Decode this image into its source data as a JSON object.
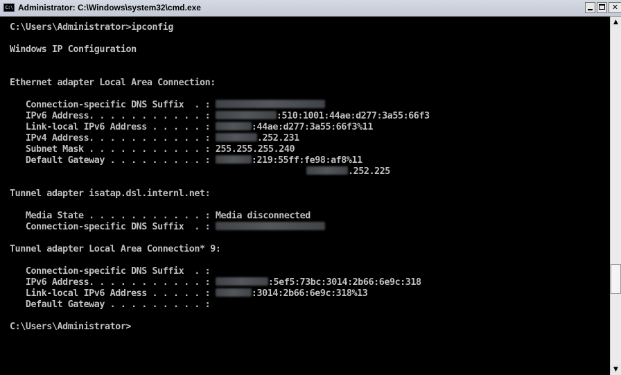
{
  "window": {
    "title": "Administrator: C:\\Windows\\system32\\cmd.exe",
    "icon": "cmd-icon",
    "icon_text": "C:\\",
    "min_label": "",
    "max_label": "",
    "close_label": "✕"
  },
  "console": {
    "prompt1": "C:\\Users\\Administrator>ipconfig",
    "header": "Windows IP Configuration",
    "eth": {
      "heading": "Ethernet adapter Local Area Connection:",
      "dns_label": "   Connection-specific DNS Suffix  . :",
      "ipv6_label": "   IPv6 Address. . . . . . . . . . . :",
      "ipv6_value": ":510:1001:44ae:d277:3a55:66f3",
      "linklocal_label": "   Link-local IPv6 Address . . . . . :",
      "linklocal_value": ":44ae:d277:3a55:66f3%11",
      "ipv4_label": "   IPv4 Address. . . . . . . . . . . :",
      "ipv4_value": ".252.231",
      "mask_label": "   Subnet Mask . . . . . . . . . . . :",
      "mask_value": " 255.255.255.240",
      "gateway_label": "   Default Gateway . . . . . . . . . :",
      "gateway_value": ":219:55ff:fe98:af8%11",
      "gateway2_value": ".252.225"
    },
    "isatap": {
      "heading": "Tunnel adapter isatap.dsl.internl.net:",
      "media_label": "   Media State . . . . . . . . . . . :",
      "media_value": " Media disconnected",
      "dns_label": "   Connection-specific DNS Suffix  . :"
    },
    "tunnel9": {
      "heading": "Tunnel adapter Local Area Connection* 9:",
      "dns_label": "   Connection-specific DNS Suffix  . :",
      "ipv6_label": "   IPv6 Address. . . . . . . . . . . :",
      "ipv6_value": ":5ef5:73bc:3014:2b66:6e9c:318",
      "linklocal_label": "   Link-local IPv6 Address . . . . . :",
      "linklocal_value": ":3014:2b66:6e9c:318%13",
      "gateway_label": "   Default Gateway . . . . . . . . . :"
    },
    "prompt2": "C:\\Users\\Administrator>"
  },
  "colors": {
    "console_bg": "#000000",
    "console_text": "#c0c0c0",
    "titlebar": "#c4cbd6"
  },
  "scrollbar": {
    "up_icon": "scroll-up-arrow-icon",
    "down_icon": "scroll-down-arrow-icon",
    "up_glyph": "▲",
    "down_glyph": "▼"
  }
}
